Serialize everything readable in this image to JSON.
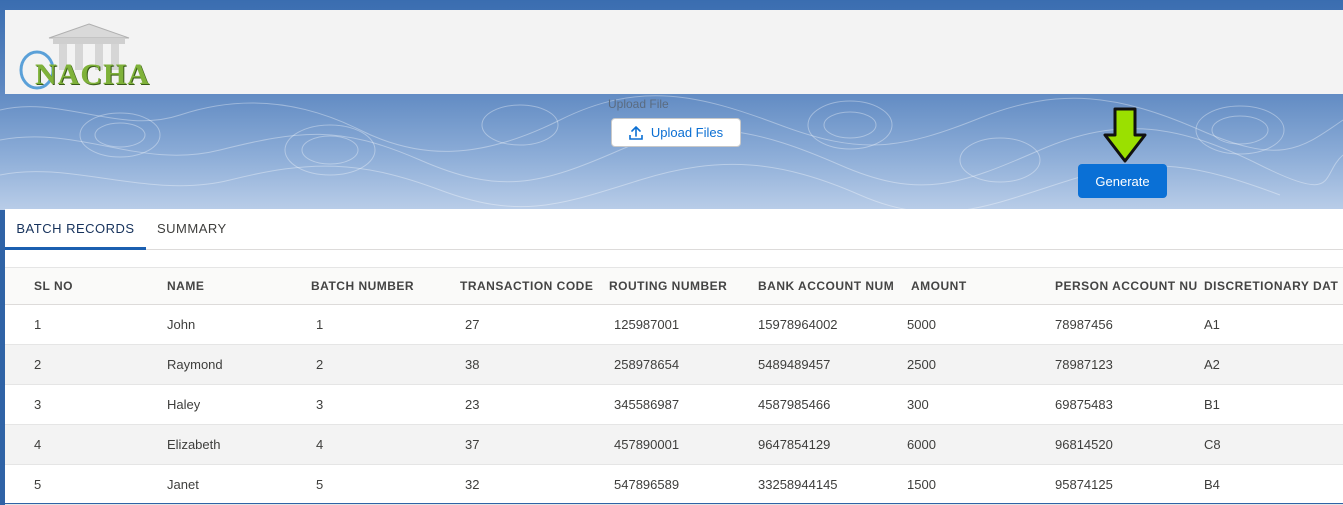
{
  "header": {
    "logo_text": "NACHA"
  },
  "upload": {
    "label": "Upload File",
    "button_label": "Upload Files"
  },
  "actions": {
    "generate_label": "Generate"
  },
  "tabs": [
    {
      "label": "BATCH RECORDS",
      "active": true
    },
    {
      "label": "SUMMARY",
      "active": false
    }
  ],
  "table": {
    "columns": [
      "SL NO",
      "NAME",
      "BATCH NUMBER",
      "TRANSACTION CODE",
      "ROUTING NUMBER",
      "BANK ACCOUNT NUM",
      "AMOUNT",
      "PERSON ACCOUNT NU",
      "DISCRETIONARY DAT"
    ],
    "rows": [
      [
        "1",
        "John",
        "1",
        "27",
        "125987001",
        "15978964002",
        "5000",
        "78987456",
        "A1"
      ],
      [
        "2",
        "Raymond",
        "2",
        "38",
        "258978654",
        "5489489457",
        "2500",
        "78987123",
        "A2"
      ],
      [
        "3",
        "Haley",
        "3",
        "23",
        "345586987",
        "4587985466",
        "300",
        "69875483",
        "B1"
      ],
      [
        "4",
        "Elizabeth",
        "4",
        "37",
        "457890001",
        "9647854129",
        "6000",
        "96814520",
        "C8"
      ],
      [
        "5",
        "Janet",
        "5",
        "32",
        "547896589",
        "33258944145",
        "1500",
        "95874125",
        "B4"
      ]
    ]
  },
  "colors": {
    "primary": "#0a70d6",
    "arrow_fill": "#9be000",
    "logo_green": "#7fb23a"
  }
}
